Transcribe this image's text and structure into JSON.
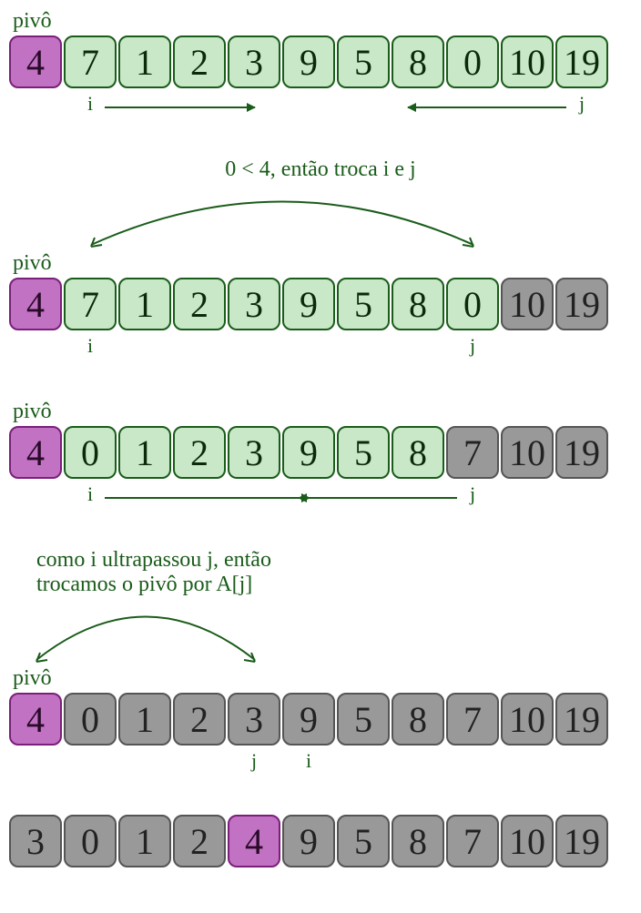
{
  "labels": {
    "pivot": "pivô",
    "i": "i",
    "j": "j"
  },
  "annotations": {
    "swap_ij": "0 < 4, então troca i e j",
    "swap_pivot_line1": "como i ultrapassou j, então",
    "swap_pivot_line2": "trocamos o pivô por A[j]"
  },
  "colors": {
    "pivot": "#c272c2",
    "green": "#c8e8c8",
    "gray": "#999999",
    "text": "#1a5c1a"
  },
  "steps": [
    {
      "show_pivot_label": true,
      "cells": [
        {
          "v": "4",
          "c": "pivot"
        },
        {
          "v": "7",
          "c": "green"
        },
        {
          "v": "1",
          "c": "green"
        },
        {
          "v": "2",
          "c": "green"
        },
        {
          "v": "3",
          "c": "green"
        },
        {
          "v": "9",
          "c": "green"
        },
        {
          "v": "5",
          "c": "green"
        },
        {
          "v": "8",
          "c": "green"
        },
        {
          "v": "0",
          "c": "green"
        },
        {
          "v": "10",
          "c": "green"
        },
        {
          "v": "19",
          "c": "green"
        }
      ],
      "i_index": 1,
      "j_index": 10,
      "i_arrow_to": 4,
      "j_arrow_from": 7
    },
    {
      "pre_annotation": "swap_ij",
      "arc": {
        "from": 1,
        "to": 8
      },
      "show_pivot_label": true,
      "cells": [
        {
          "v": "4",
          "c": "pivot"
        },
        {
          "v": "7",
          "c": "green"
        },
        {
          "v": "1",
          "c": "green"
        },
        {
          "v": "2",
          "c": "green"
        },
        {
          "v": "3",
          "c": "green"
        },
        {
          "v": "9",
          "c": "green"
        },
        {
          "v": "5",
          "c": "green"
        },
        {
          "v": "8",
          "c": "green"
        },
        {
          "v": "0",
          "c": "green"
        },
        {
          "v": "10",
          "c": "gray"
        },
        {
          "v": "19",
          "c": "gray"
        }
      ],
      "i_index": 1,
      "j_index": 8
    },
    {
      "show_pivot_label": true,
      "cells": [
        {
          "v": "4",
          "c": "pivot"
        },
        {
          "v": "0",
          "c": "green"
        },
        {
          "v": "1",
          "c": "green"
        },
        {
          "v": "2",
          "c": "green"
        },
        {
          "v": "3",
          "c": "green"
        },
        {
          "v": "9",
          "c": "green"
        },
        {
          "v": "5",
          "c": "green"
        },
        {
          "v": "8",
          "c": "green"
        },
        {
          "v": "7",
          "c": "gray"
        },
        {
          "v": "10",
          "c": "gray"
        },
        {
          "v": "19",
          "c": "gray"
        }
      ],
      "i_index": 1,
      "j_index": 8,
      "i_arrow_to": 5,
      "j_arrow_from": 5
    },
    {
      "pre_annotation_multi": [
        "swap_pivot_line1",
        "swap_pivot_line2"
      ],
      "arc": {
        "from": 0,
        "to": 4
      },
      "show_pivot_label": true,
      "cells": [
        {
          "v": "4",
          "c": "pivot"
        },
        {
          "v": "0",
          "c": "gray"
        },
        {
          "v": "1",
          "c": "gray"
        },
        {
          "v": "2",
          "c": "gray"
        },
        {
          "v": "3",
          "c": "gray"
        },
        {
          "v": "9",
          "c": "gray"
        },
        {
          "v": "5",
          "c": "gray"
        },
        {
          "v": "8",
          "c": "gray"
        },
        {
          "v": "7",
          "c": "gray"
        },
        {
          "v": "10",
          "c": "gray"
        },
        {
          "v": "19",
          "c": "gray"
        }
      ],
      "i_index": 5,
      "j_index": 4
    },
    {
      "show_pivot_label": false,
      "cells": [
        {
          "v": "3",
          "c": "gray"
        },
        {
          "v": "0",
          "c": "gray"
        },
        {
          "v": "1",
          "c": "gray"
        },
        {
          "v": "2",
          "c": "gray"
        },
        {
          "v": "4",
          "c": "pivot"
        },
        {
          "v": "9",
          "c": "gray"
        },
        {
          "v": "5",
          "c": "gray"
        },
        {
          "v": "8",
          "c": "gray"
        },
        {
          "v": "7",
          "c": "gray"
        },
        {
          "v": "10",
          "c": "gray"
        },
        {
          "v": "19",
          "c": "gray"
        }
      ]
    }
  ]
}
